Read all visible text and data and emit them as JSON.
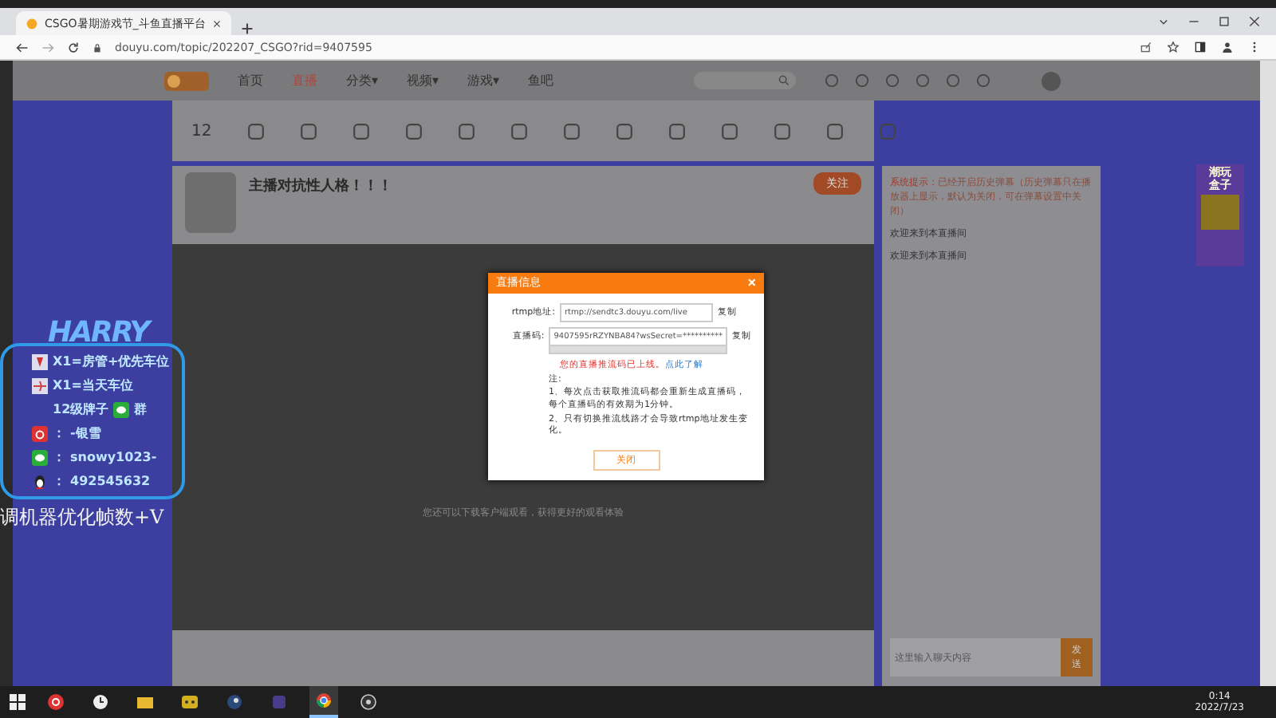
{
  "browser": {
    "tab_title": "CSGO暑期游戏节_斗鱼直播平台",
    "url": "douyu.com/topic/202207_CSGO?rid=9407595"
  },
  "site_nav": {
    "items": [
      {
        "label": "首页",
        "selected": false
      },
      {
        "label": "直播",
        "selected": true
      },
      {
        "label": "分类▾",
        "selected": false
      },
      {
        "label": "视频▾",
        "selected": false
      },
      {
        "label": "游戏▾",
        "selected": false
      },
      {
        "label": "鱼吧",
        "selected": false
      }
    ]
  },
  "toolbar": {
    "count": "12"
  },
  "room": {
    "title": "主播对抗性人格！！！",
    "follow": "关注"
  },
  "video": {
    "hint": "您还可以下载客户端观看，获得更好的观看体验"
  },
  "dialog": {
    "title": "直播信息",
    "close": "×",
    "fields": [
      {
        "label": "rtmp地址:",
        "value": "rtmp://sendtc3.douyu.com/live",
        "copy": "复制"
      },
      {
        "label": "直播码:",
        "value": "9407595rRZYNBA84?wsSecret=**********",
        "copy": "复制"
      }
    ],
    "status": "您的直播推流码已上线。",
    "status_link": "点此了解",
    "notes": [
      "注:",
      "1、每次点击获取推流码都会重新生成直播码，每个直播码的有效期为1分钟。",
      "2、只有切换推流线路才会导致rtmp地址发生变化。"
    ],
    "button": "关闭"
  },
  "overlay": {
    "logo": "HARRY",
    "lines": [
      {
        "text": "X1=房管+优先车位"
      },
      {
        "text": "X1=当天车位"
      },
      {
        "text": "12级牌子",
        "suffix": "群"
      },
      {
        "sep": "：",
        "text": "-银雪"
      },
      {
        "sep": "：",
        "text": "snowy1023-"
      },
      {
        "sep": "：",
        "text": "492545632"
      }
    ],
    "caption": "调机器优化帧数+V"
  },
  "chat": {
    "messages": [
      {
        "kind": "system",
        "tag": "系统提示：",
        "text": "已经开启历史弹幕（历史弹幕只在播放器上显示，默认为关闭，可在弹幕设置中关闭）"
      },
      {
        "kind": "welcome",
        "text": "欢迎来到本直播间"
      },
      {
        "kind": "welcome",
        "text": "欢迎来到本直播间"
      }
    ],
    "input_placeholder": "这里输入聊天内容",
    "send": "发送"
  },
  "banner": {
    "title": "潮玩盒子"
  },
  "taskbar": {
    "apps": [
      {
        "kind": "netease",
        "selected": false
      },
      {
        "kind": "clock",
        "selected": false
      },
      {
        "kind": "folder",
        "selected": false
      },
      {
        "kind": "game",
        "selected": false
      },
      {
        "kind": "steam",
        "selected": false
      },
      {
        "kind": "app",
        "selected": false
      },
      {
        "kind": "chrome",
        "selected": true
      },
      {
        "kind": "obs",
        "selected": false
      }
    ],
    "time": "0:14",
    "date": "2022/7/23"
  }
}
